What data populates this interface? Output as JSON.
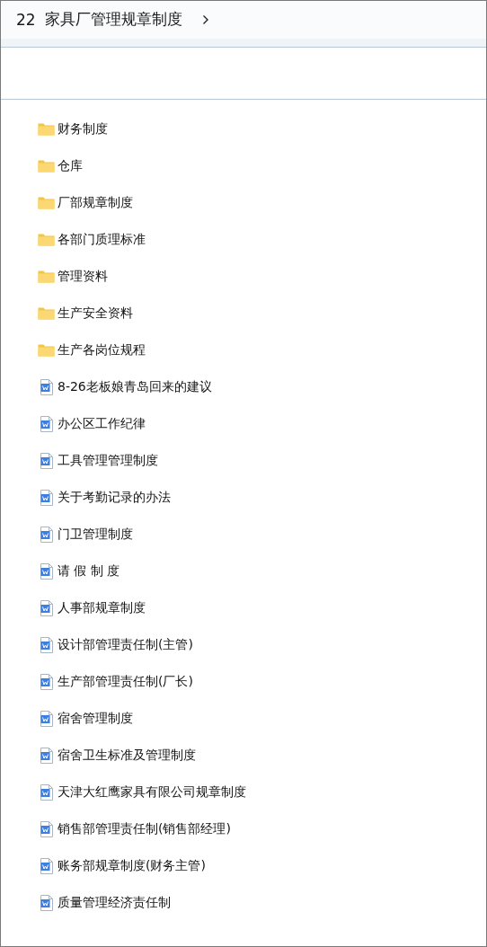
{
  "header": {
    "number": "22",
    "title": "家具厂管理规章制度"
  },
  "items": [
    {
      "kind": "folder",
      "name": "财务制度"
    },
    {
      "kind": "folder",
      "name": "仓库"
    },
    {
      "kind": "folder",
      "name": "厂部规章制度"
    },
    {
      "kind": "folder",
      "name": "各部门质理标准"
    },
    {
      "kind": "folder",
      "name": "管理资料"
    },
    {
      "kind": "folder",
      "name": "生产安全资料"
    },
    {
      "kind": "folder",
      "name": "生产各岗位规程"
    },
    {
      "kind": "doc",
      "name": "8-26老板娘青岛回来的建议"
    },
    {
      "kind": "doc",
      "name": "办公区工作纪律"
    },
    {
      "kind": "doc",
      "name": "工具管理管理制度"
    },
    {
      "kind": "doc",
      "name": "关于考勤记录的办法"
    },
    {
      "kind": "doc",
      "name": "门卫管理制度"
    },
    {
      "kind": "doc",
      "name": "请 假 制 度"
    },
    {
      "kind": "doc",
      "name": "人事部规章制度"
    },
    {
      "kind": "doc",
      "name": "设计部管理责任制(主管)"
    },
    {
      "kind": "doc",
      "name": "生产部管理责任制(厂长)"
    },
    {
      "kind": "doc",
      "name": "宿舍管理制度"
    },
    {
      "kind": "doc",
      "name": "宿舍卫生标准及管理制度"
    },
    {
      "kind": "doc",
      "name": "天津大红鹰家具有限公司规章制度"
    },
    {
      "kind": "doc",
      "name": "销售部管理责任制(销售部经理)"
    },
    {
      "kind": "doc",
      "name": "账务部规章制度(财务主管)"
    },
    {
      "kind": "doc",
      "name": "质量管理经济责任制"
    }
  ]
}
